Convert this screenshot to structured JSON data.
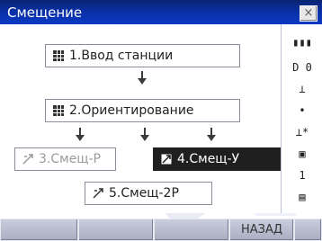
{
  "window": {
    "title": "Смещение",
    "close_label": "×"
  },
  "menu": {
    "items": [
      {
        "label": "1.Ввод станции",
        "icon": "grid-icon"
      },
      {
        "label": "2.Ориентирование",
        "icon": "grid-icon"
      },
      {
        "label": "3.Смещ-Р",
        "icon": "offset-icon"
      },
      {
        "label": "4.Смещ-У",
        "icon": "offset-icon"
      },
      {
        "label": "5.Смещ-2Р",
        "icon": "offset-icon"
      }
    ],
    "selected_index": 3
  },
  "status_bar": {
    "battery": "▮▮▮",
    "mode": "D 0",
    "target": "⊥",
    "tilt": "•",
    "ppm": "⊥*",
    "memory": "▣",
    "page": "1",
    "input": "▤"
  },
  "softkeys": [
    "",
    "",
    "",
    "НАЗАД"
  ],
  "colors": {
    "title_bar": "#0b39c4",
    "selected": "#1f1f1f",
    "softkey": "#b9bdd0"
  }
}
